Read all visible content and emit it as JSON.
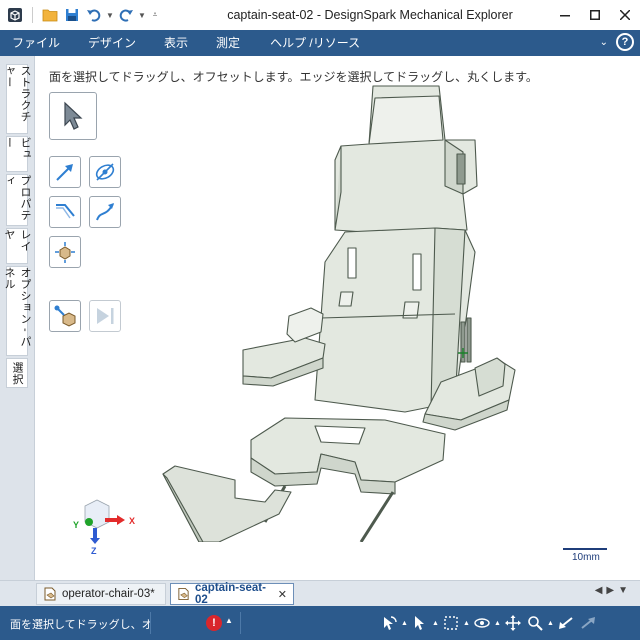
{
  "window": {
    "title": "captain-seat-02 - DesignSpark Mechanical Explorer"
  },
  "menu": {
    "items": [
      "ファイル",
      "デザイン",
      "表示",
      "測定",
      "ヘルプ /リソース"
    ]
  },
  "side_tabs": [
    "ストラクチャー",
    "ビュー",
    "プロパティ",
    "レイヤ",
    "オプション - パネル",
    "選択"
  ],
  "canvas": {
    "hint": "面を選択してドラッグし、オフセットします。エッジを選択してドラッグし、丸くします。",
    "scale_label": "10mm",
    "triad": {
      "x_label": "X",
      "y_label": "Y",
      "z_label": "Z"
    }
  },
  "tools": {
    "select": "select-arrow-icon",
    "pull": "pull-icon",
    "move": "move-icon",
    "fill": "fill-icon",
    "blend": "blend-icon",
    "combine": "combine-icon",
    "assembly": "assembly-icon",
    "play": "play-icon"
  },
  "doc_tabs": [
    {
      "label": "operator-chair-03*",
      "active": false
    },
    {
      "label": "captain-seat-02",
      "active": true,
      "close": "✕"
    }
  ],
  "status": {
    "text": "面を選択してドラッグし、オフセットします。",
    "error_glyph": "!"
  },
  "colors": {
    "accent": "#2c5a8c",
    "model_fill": "#e3e8e0",
    "model_edge": "#4e5a4e",
    "error": "#d9262c"
  }
}
